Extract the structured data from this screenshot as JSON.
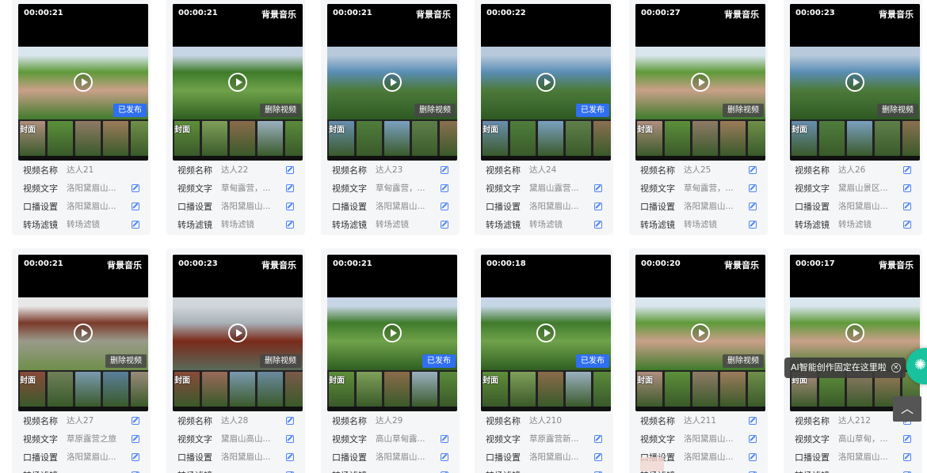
{
  "labels": {
    "name": "视频名称",
    "text": "视频文字",
    "voice": "口播设置",
    "filter": "转场滤镜",
    "music": "背景音乐",
    "cover": "封面",
    "published": "已发布",
    "delete": "删除视频"
  },
  "cards": [
    {
      "duration": "00:00:21",
      "music": false,
      "badge": "published",
      "name": "达人21",
      "text": "洛阳黛眉山...",
      "voice": "洛阳黛眉山...",
      "filter": "转场滤镜",
      "theme": "cliff",
      "editable": false
    },
    {
      "duration": "00:00:21",
      "music": true,
      "badge": "delete",
      "name": "达人22",
      "text": "草甸露营，...",
      "voice": "洛阳黛眉山...",
      "filter": "转场滤镜",
      "theme": "ridge",
      "editable": true
    },
    {
      "duration": "00:00:21",
      "music": true,
      "badge": "delete",
      "name": "达人23",
      "text": "草甸露营，...",
      "voice": "洛阳黛眉山...",
      "filter": "转场滤镜",
      "theme": "lake",
      "editable": true
    },
    {
      "duration": "00:00:22",
      "music": false,
      "badge": "published",
      "name": "达人24",
      "text": "黛眉山露营...",
      "voice": "洛阳黛眉山...",
      "filter": "转场滤镜",
      "theme": "lake",
      "editable": false
    },
    {
      "duration": "00:00:27",
      "music": true,
      "badge": "delete",
      "name": "达人25",
      "text": "草甸露营，...",
      "voice": "洛阳黛眉山...",
      "filter": "转场滤镜",
      "theme": "cliff",
      "editable": true
    },
    {
      "duration": "00:00:23",
      "music": true,
      "badge": "delete",
      "name": "达人26",
      "text": "黛眉山景区...",
      "voice": "洛阳黛眉山...",
      "filter": "转场滤镜",
      "theme": "lake",
      "editable": true
    },
    {
      "duration": "00:00:21",
      "music": true,
      "badge": "delete",
      "name": "达人27",
      "text": "草原露营之旅",
      "voice": "洛阳黛眉山...",
      "filter": "",
      "theme": "temple",
      "editable": true
    },
    {
      "duration": "00:00:23",
      "music": true,
      "badge": "delete",
      "name": "达人28",
      "text": "黛眉山高山...",
      "voice": "洛阳黛眉山...",
      "filter": "",
      "theme": "pagoda",
      "editable": true
    },
    {
      "duration": "00:00:21",
      "music": false,
      "badge": "published",
      "name": "达人29",
      "text": "高山草甸露...",
      "voice": "洛阳黛眉山...",
      "filter": "",
      "theme": "ridge",
      "editable": false
    },
    {
      "duration": "00:00:18",
      "music": false,
      "badge": "published",
      "name": "达人210",
      "text": "草原露营新...",
      "voice": "洛阳黛眉山...",
      "filter": "",
      "theme": "ridge",
      "editable": false
    },
    {
      "duration": "00:00:20",
      "music": true,
      "badge": "delete",
      "name": "达人211",
      "text": "洛阳黛眉山...",
      "voice": "洛阳黛眉山...",
      "filter": "",
      "theme": "cliff",
      "editable": true
    },
    {
      "duration": "00:00:17",
      "music": true,
      "badge": "none",
      "name": "达人212",
      "text": "高山草甸，...",
      "voice": "洛阳黛眉山...",
      "filter": "",
      "theme": "cliff",
      "editable": true
    }
  ],
  "tooltip": {
    "text": "AI智能创作固定在这里啦",
    "close": "×"
  },
  "ai_button_icon": "ai-assistant-icon",
  "back_to_top": "︿",
  "colors": {
    "accent": "#2f6ff0",
    "card_bg": "#f5f6f8",
    "ai_green": "#18c29c"
  }
}
